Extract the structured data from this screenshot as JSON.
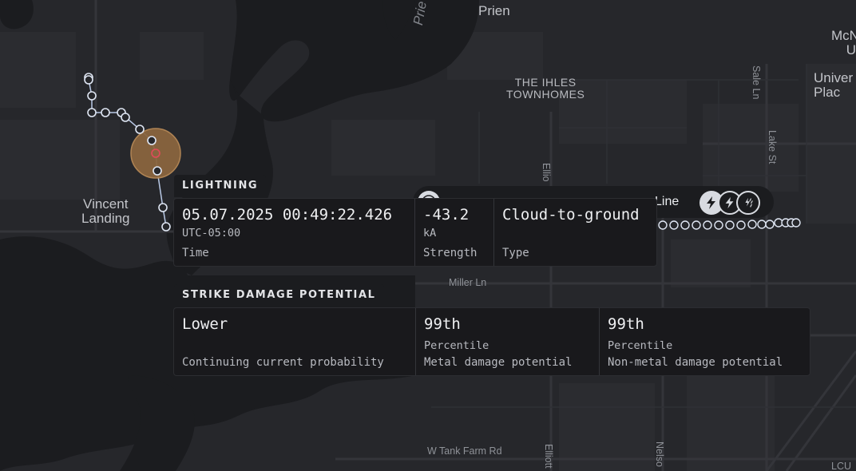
{
  "map": {
    "places": {
      "prien": "Prien",
      "prien_lake": "Prie",
      "ihles": [
        "THE IHLES",
        "TOWNHOMES"
      ],
      "vincent": [
        "Vincent",
        "Landing"
      ],
      "mcn": [
        "McN",
        "U"
      ],
      "university": [
        "Univer",
        "Plac"
      ]
    },
    "streets": {
      "sale_ln": "Sale Ln",
      "lake_st": "Lake St",
      "ellio": "Ellio",
      "miller_ln": "Miller Ln",
      "tank_farm": "W Tank Farm Rd",
      "elliott": "Elliott",
      "nelson": "Nelso",
      "lcu": "LCU"
    }
  },
  "storm_line": {
    "label": "Line",
    "lightning_icon": "lightning-bolt-icon",
    "lightning_alt_icon": "lightning-bolt-outline-icon",
    "rain_icon": "rain-bolt-icon",
    "target_icon": "target-icon"
  },
  "lightning": {
    "title": "LIGHTNING",
    "time_value": "05.07.2025 00:49:22.426",
    "time_zone": "UTC-05:00",
    "time_label": "Time",
    "strength_value": "-43.2",
    "strength_unit": "kA",
    "strength_label": "Strength",
    "type_value": "Cloud-to-ground",
    "type_label": "Type"
  },
  "damage": {
    "title": "STRIKE DAMAGE POTENTIAL",
    "cc_value": "Lower",
    "cc_label": "Continuing current probability",
    "metal_value": "99th",
    "metal_unit": "Percentile",
    "metal_label": "Metal damage potential",
    "nonmetal_value": "99th",
    "nonmetal_unit": "Percentile",
    "nonmetal_label": "Non-metal damage potential"
  },
  "colors": {
    "land": "#26272b",
    "water": "#1b1c1f",
    "road": "#34353a",
    "track": "#b9c9e6",
    "strike_fill": "#8a653f",
    "strike_ring": "#b88a57"
  }
}
